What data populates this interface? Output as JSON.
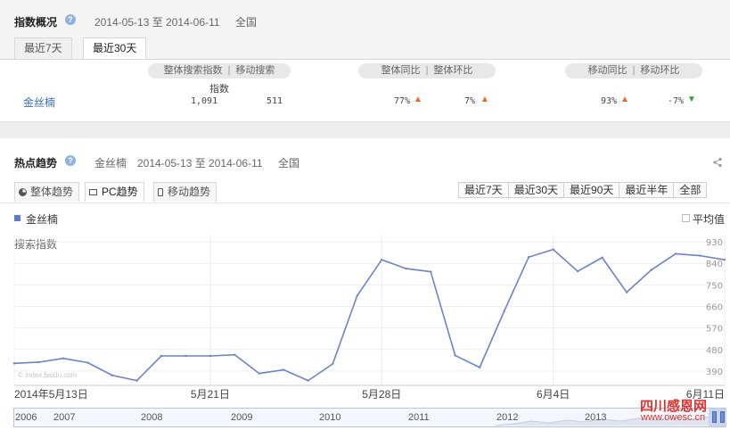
{
  "overview": {
    "title": "指数概况",
    "date_range": "2014-05-13 至 2014-06-11",
    "region": "全国",
    "tabs": [
      "最近7天",
      "最近30天"
    ],
    "headers": {
      "search_index": "整体搜索指数",
      "mobile_search": "移动搜索",
      "yoy": "整体同比",
      "mom": "整体环比",
      "mobile_yoy": "移动同比",
      "mobile_mom": "移动环比",
      "index_word": "指数",
      "sep": "|"
    },
    "row": {
      "keyword": "金丝楠",
      "search_index": "1,091",
      "mobile_search": "511",
      "yoy": "77%",
      "mom": "7%",
      "mobile_yoy": "93%",
      "mobile_mom": "-7%"
    }
  },
  "trend": {
    "title": "热点趋势",
    "keyword": "金丝楠",
    "date_range": "2014-05-13 至 2014-06-11",
    "region": "全国",
    "subtabs": [
      "整体趋势",
      "PC趋势",
      "移动趋势"
    ],
    "range_buttons": [
      "最近7天",
      "最近30天",
      "最近90天",
      "最近半年",
      "全部"
    ],
    "legend_label": "金丝楠",
    "avg_label": "平均值",
    "ylabel": "搜索指数",
    "watermark_src": "© index.baidu.com",
    "nav_years": [
      "2006",
      "2007",
      "2008",
      "2009",
      "2010",
      "2011",
      "2012",
      "2013"
    ],
    "brand_watermark": "四川感恩网",
    "brand_url": "www.owesc.cn"
  },
  "chart_data": {
    "type": "line",
    "ylabel": "搜索指数",
    "yticks": [
      390,
      480,
      570,
      660,
      750,
      840,
      930
    ],
    "ylim": [
      330,
      960
    ],
    "xticks": [
      "2014年5月13日",
      "5月21日",
      "5月28日",
      "6月4日",
      "6月11日"
    ],
    "series": [
      {
        "name": "金丝楠",
        "color": "#6b84c9",
        "x": [
          "2014-05-13",
          "2014-05-14",
          "2014-05-15",
          "2014-05-16",
          "2014-05-17",
          "2014-05-18",
          "2014-05-19",
          "2014-05-20",
          "2014-05-21",
          "2014-05-22",
          "2014-05-23",
          "2014-05-24",
          "2014-05-25",
          "2014-05-26",
          "2014-05-27",
          "2014-05-28",
          "2014-05-29",
          "2014-05-30",
          "2014-05-31",
          "2014-06-01",
          "2014-06-02",
          "2014-06-03",
          "2014-06-04",
          "2014-06-05",
          "2014-06-06",
          "2014-06-07",
          "2014-06-08",
          "2014-06-09",
          "2014-06-10",
          "2014-06-11"
        ],
        "values": [
          422,
          427,
          443,
          425,
          372,
          350,
          453,
          453,
          453,
          458,
          380,
          395,
          350,
          420,
          705,
          855,
          818,
          805,
          455,
          405,
          640,
          866,
          898,
          807,
          864,
          719,
          812,
          880,
          872,
          855
        ]
      }
    ],
    "grid": true,
    "legend": "top-left"
  }
}
